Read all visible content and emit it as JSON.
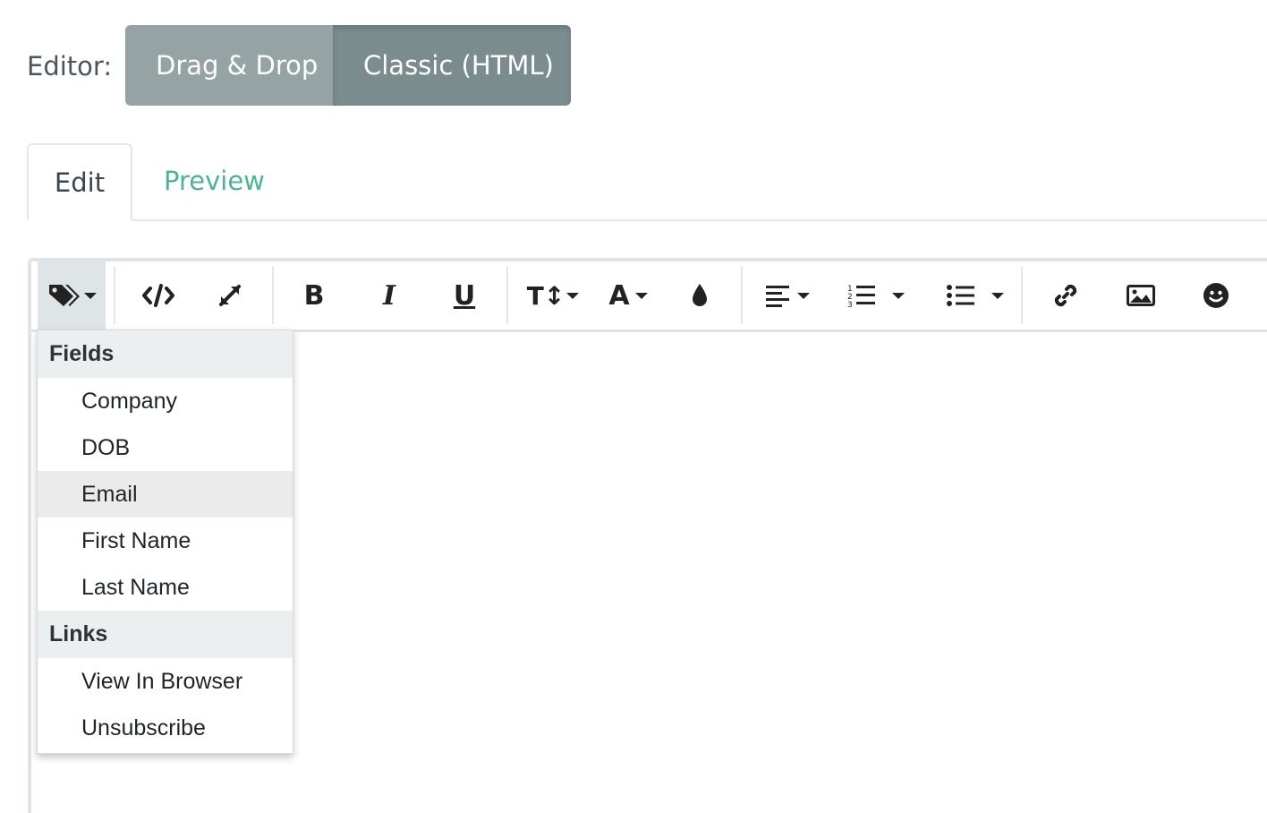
{
  "editor": {
    "label": "Editor:",
    "modes": [
      "Drag & Drop",
      "Classic (HTML)"
    ],
    "active_mode": "Classic (HTML)"
  },
  "tabs": {
    "edit": "Edit",
    "preview": "Preview",
    "active": "Edit"
  },
  "toolbar": {
    "buttons": [
      "merge-tags",
      "code-view",
      "fullscreen",
      "bold",
      "italic",
      "underline",
      "font-size",
      "font-color",
      "color-fill",
      "align",
      "ordered-list",
      "unordered-list",
      "link",
      "image",
      "emoji"
    ],
    "bold_glyph": "B",
    "italic_glyph": "I",
    "underline_glyph": "U",
    "font_size_glyph": "T↕",
    "font_glyph": "A"
  },
  "dropdown": {
    "sections": [
      {
        "header": "Fields",
        "items": [
          "Company",
          "DOB",
          "Email",
          "First Name",
          "Last Name"
        ]
      },
      {
        "header": "Links",
        "items": [
          "View In Browser",
          "Unsubscribe"
        ]
      }
    ],
    "highlighted_item": "Email"
  },
  "colors": {
    "mode_drag_drop": "#95a3a4",
    "mode_classic": "#7b8c8e",
    "preview_tab": "#4eb38f",
    "border": "#dfe4e8"
  }
}
